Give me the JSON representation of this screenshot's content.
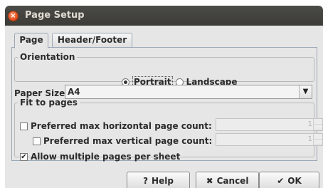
{
  "window": {
    "title": "Page Setup",
    "close_icon": "close-icon"
  },
  "tabs": [
    {
      "label": "Page",
      "active": true
    },
    {
      "label": "Header/Footer",
      "active": false
    }
  ],
  "orientation": {
    "legend": "Orientation",
    "options": [
      {
        "label": "Portrait",
        "selected": true
      },
      {
        "label": "Landscape",
        "selected": false
      }
    ]
  },
  "paper_size": {
    "label": "Paper Size",
    "value": "A4"
  },
  "fit_to_pages": {
    "legend": "Fit to pages",
    "horizontal": {
      "label": "Preferred max horizontal page count:",
      "checked": false,
      "value": "1"
    },
    "vertical": {
      "label": "Preferred max vertical page count:",
      "checked": false,
      "value": "1"
    },
    "multiple": {
      "label": "Allow multiple pages per sheet",
      "checked": true
    }
  },
  "buttons": {
    "help": {
      "label": "Help",
      "icon": "question-icon"
    },
    "cancel": {
      "label": "Cancel",
      "icon": "cancel-x-icon"
    },
    "ok": {
      "label": "OK",
      "icon": "checkmark-icon"
    }
  },
  "colors": {
    "titlebar": "#3c3b37",
    "close_button": "#df4a16",
    "dialog_bg": "#e6e6e6"
  }
}
